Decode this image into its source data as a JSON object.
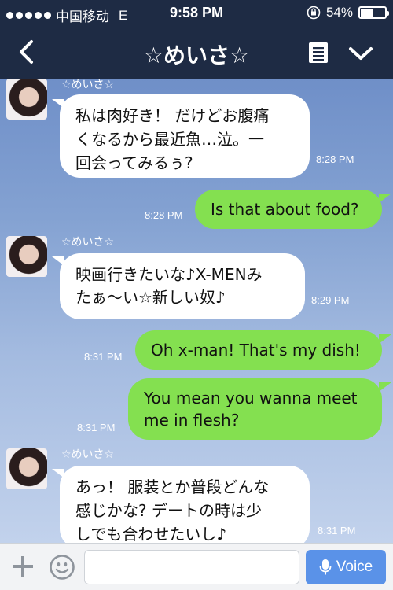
{
  "status_bar": {
    "carrier": "中国移动",
    "network": "E",
    "time": "9:58 PM",
    "battery": "54%",
    "battery_level": 0.54
  },
  "nav": {
    "title": "☆めいさ☆",
    "icons": [
      "back-chevron-icon",
      "notes-icon",
      "chevron-down-icon"
    ]
  },
  "messages": [
    {
      "from": "them",
      "sender": "☆めいさ☆",
      "lines": [
        "私は肉好き！ だけどお腹痛",
        "くなるから最近魚…泣。一",
        "回会ってみるぅ?"
      ],
      "time": "8:28 PM"
    },
    {
      "from": "me",
      "lines": [
        "Is that about food?"
      ],
      "time": "8:28 PM"
    },
    {
      "from": "them",
      "sender": "☆めいさ☆",
      "lines": [
        "映画行きたいな♪X-MENみ",
        "たぁ～い☆新しい奴♪"
      ],
      "time": "8:29 PM"
    },
    {
      "from": "me",
      "lines": [
        "Oh x-man! That's my dish!"
      ],
      "time": "8:31 PM"
    },
    {
      "from": "me",
      "lines": [
        "You mean you wanna meet",
        "me in flesh?"
      ],
      "time": "8:31 PM"
    },
    {
      "from": "them",
      "sender": "☆めいさ☆",
      "lines": [
        "あっ！ 服装とか普段どんな",
        "感じかな? デートの時は少",
        "しでも合わせたいし♪"
      ],
      "time": "8:31 PM"
    }
  ],
  "input_bar": {
    "voice_label": "Voice",
    "text_value": ""
  },
  "colors": {
    "header": "#1e2b44",
    "incoming_bubble": "#ffffff",
    "outgoing_bubble": "#84e050",
    "voice_button": "#5a92e8"
  }
}
